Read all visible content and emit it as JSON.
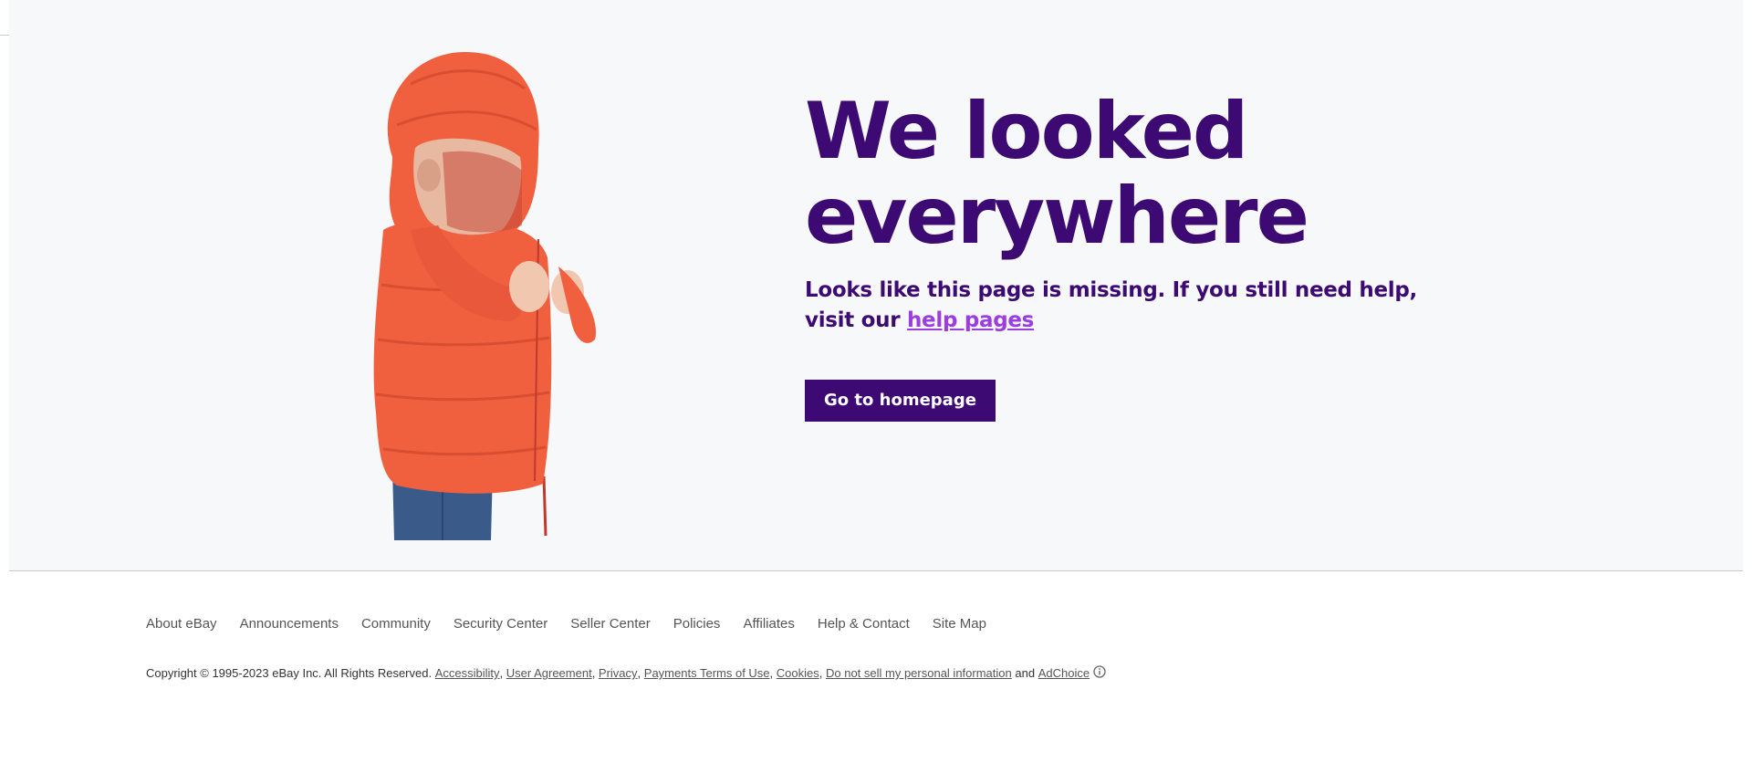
{
  "hero": {
    "headline_line1": "We looked",
    "headline_line2": "everywhere",
    "subtext_before": "Looks like this page is missing. If you still need help, visit our ",
    "help_link": "help pages",
    "cta": "Go to homepage"
  },
  "footer": {
    "links": [
      "About eBay",
      "Announcements",
      "Community",
      "Security Center",
      "Seller Center",
      "Policies",
      "Affiliates",
      "Help & Contact",
      "Site Map"
    ],
    "copyright_text": "Copyright © 1995-2023 eBay Inc. All Rights Reserved.",
    "legal_links": [
      "Accessibility",
      "User Agreement",
      "Privacy",
      "Payments Terms of Use",
      "Cookies",
      "Do not sell my personal information"
    ],
    "and_text": "and",
    "adchoice": "AdChoice"
  },
  "colors": {
    "brand_purple": "#3c0a72",
    "link_purple": "#9b3ee0",
    "jacket_orange": "#f0603f",
    "hero_background": "#f7f8fa"
  },
  "icons": {
    "adchoice": "info-circle-icon"
  }
}
